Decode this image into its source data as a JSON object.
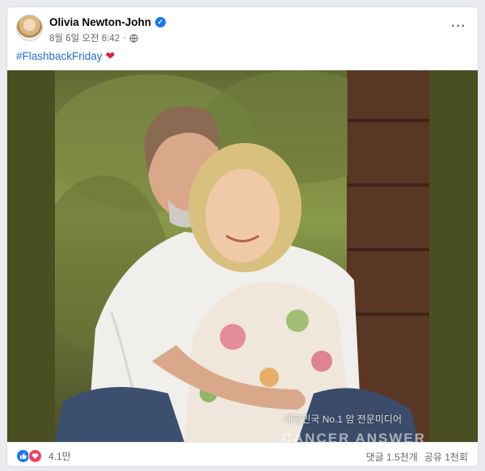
{
  "post": {
    "author": "Olivia Newton-John",
    "date": "8월 6일 오전 6:42",
    "separator": "·",
    "caption_hashtag": "#FlashbackFriday",
    "verified_glyph": "✓",
    "more_glyph": "···",
    "heart_glyph": "❤",
    "image": {
      "watermark_text": "대한민국 No.1 암 전문미디어",
      "watermark_logo": "CANCER  ANSWER"
    }
  },
  "footer": {
    "reaction_count": "4.1만",
    "comments": "댓글 1.5천개",
    "shares": "공유 1천회"
  },
  "colors": {
    "brand_blue": "#1877f2",
    "hashtag_blue": "#216fdb",
    "love_red": "#f33e58",
    "photo_border": "#4a4f22"
  },
  "icons": [
    "verified-icon",
    "globe-icon",
    "more-icon",
    "heart-emoji",
    "like-reaction-icon",
    "love-reaction-icon"
  ]
}
